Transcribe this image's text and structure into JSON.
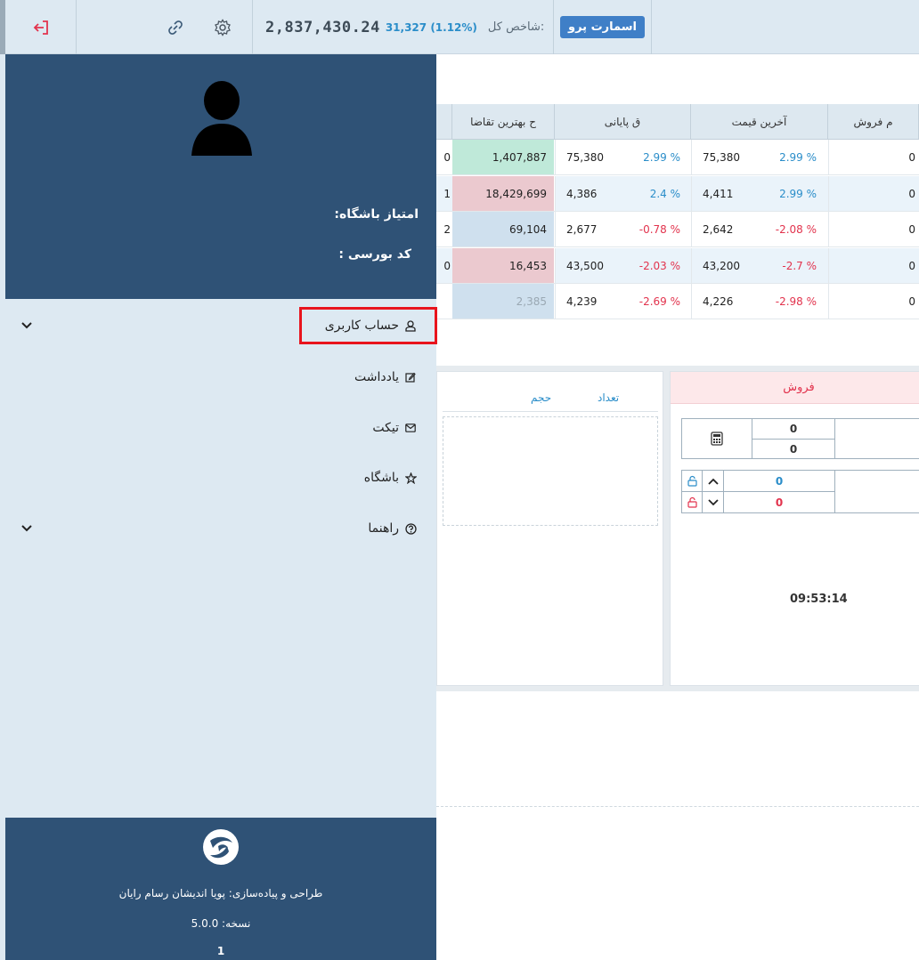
{
  "topbar": {
    "index_label": "شاخص کل:",
    "index_value": "2,837,430.24",
    "index_change": "31,327 (1.12%)",
    "smart_button": "اسمارت پرو",
    "icons": [
      "exit-icon",
      "link-icon",
      "gear-icon"
    ],
    "exit_icon_color": "#e2334d"
  },
  "grid": {
    "columns": [
      "ح بهترین تقاضا",
      "ق پایانی",
      "آخرین قیمت",
      "م فروش"
    ],
    "row_edge_digits": [
      "0",
      "1",
      "2",
      "0",
      ""
    ],
    "rows": [
      {
        "best_bid_vol": "1,407,887",
        "close_price": "75,380",
        "close_pct": "2.99 %",
        "last_price": "75,380",
        "last_pct": "2.99 %",
        "sell_vol": "0",
        "bid_bg": "#bfe9d9"
      },
      {
        "best_bid_vol": "18,429,699",
        "close_price": "4,386",
        "close_pct": "2.4 %",
        "last_price": "4,411",
        "last_pct": "2.99 %",
        "sell_vol": "0",
        "bid_bg": "#ebc9cf"
      },
      {
        "best_bid_vol": "69,104",
        "close_price": "2,677",
        "close_pct": "-0.78 %",
        "last_price": "2,642",
        "last_pct": "-2.08 %",
        "sell_vol": "0",
        "bid_bg": "#cfe0ee"
      },
      {
        "best_bid_vol": "16,453",
        "close_price": "43,500",
        "close_pct": "-2.03 %",
        "last_price": "43,200",
        "last_pct": "-2.7 %",
        "sell_vol": "0",
        "bid_bg": "#ebc9cf"
      },
      {
        "best_bid_vol": "2,385",
        "close_price": "4,239",
        "close_pct": "-2.69 %",
        "last_price": "4,226",
        "last_pct": "-2.98 %",
        "sell_vol": "0",
        "bid_bg": "#cfe0ee"
      }
    ]
  },
  "orderbook": {
    "col_count": "تعداد",
    "col_volume": "حجم"
  },
  "trade_panel": {
    "sell_title": "فروش",
    "calc_top": "0",
    "calc_bottom": "0",
    "up_value": "0",
    "down_value": "0",
    "clock": "09:53:14"
  },
  "sidebar": {
    "club_score_label": "امتیاز باشگاه:",
    "bourse_code_label": "کد بورسی :",
    "menu": [
      {
        "label": "حساب کاربری",
        "icon": "user-icon",
        "expandable": true
      },
      {
        "label": "یادداشت",
        "icon": "note-edit-icon",
        "expandable": false
      },
      {
        "label": "تیکت",
        "icon": "mail-icon",
        "expandable": false
      },
      {
        "label": "باشگاه",
        "icon": "star-icon",
        "expandable": false
      },
      {
        "label": "راهنما",
        "icon": "help-icon",
        "expandable": true
      }
    ],
    "designer": "طراحی و پیاده‌سازی: پویا اندیشان رسام رایان",
    "version": "نسخه: 5.0.0",
    "page_number": "1"
  },
  "colors": {
    "sidebar_dark": "#2f5276",
    "sidebar_light": "#dde9f2",
    "positive": "#2a8dc9",
    "negative": "#e2334d",
    "highlight": "#e8141d"
  }
}
